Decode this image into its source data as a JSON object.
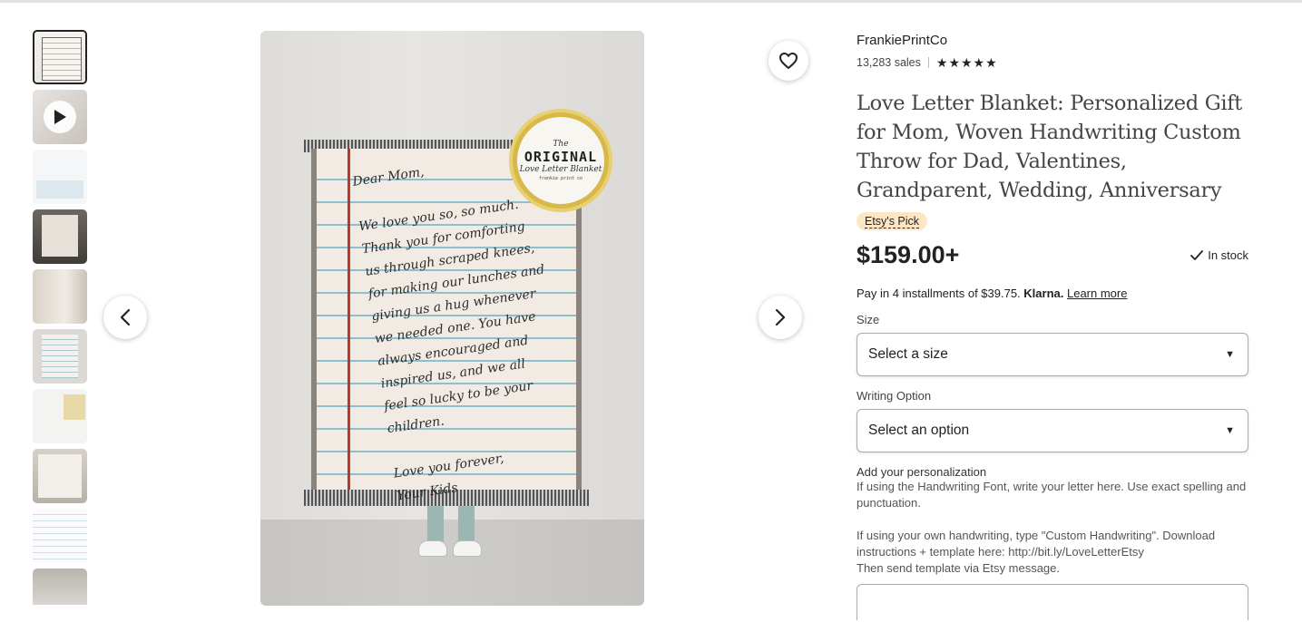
{
  "shop": {
    "name": "FrankiePrintCo",
    "sales": "13,283 sales",
    "stars": "★★★★★"
  },
  "product": {
    "title": "Love Letter Blanket: Personalized Gift for Mom, Woven Handwriting Custom Throw for Dad, Valentines, Grandparent, Wedding, Anniversary",
    "badge": "Etsy's Pick",
    "price": "$159.00+",
    "stock": "In stock",
    "installments_prefix": "Pay in 4 installments of $39.75. ",
    "installments_brand": "Klarna.",
    "learn_more": "Learn more"
  },
  "options": {
    "size_label": "Size",
    "size_placeholder": "Select a size",
    "writing_label": "Writing Option",
    "writing_placeholder": "Select an option"
  },
  "personalization": {
    "title": "Add your personalization",
    "instructions": "If using the Handwriting Font, write your letter here. Use exact spelling and punctuation.\n\nIf using your own handwriting, type \"Custom Handwriting\". Download instructions + template here: http://bit.ly/LoveLetterEtsy\nThen send template via Etsy message."
  },
  "image": {
    "letter": "Dear Mom,\n\nWe love you so, so much.\nThank you for comforting\nus through scraped knees,\nfor making our lunches and\ngiving us a hug whenever\nwe needed one. You have\nalways encouraged and\ninspired us, and we all\nfeel so lucky to be your\nchildren.\n\n      Love you forever,\n          Your Kids",
    "badge_top": "The",
    "badge_main": "ORIGINAL",
    "badge_sub": "Love Letter Blanket",
    "badge_maker": "frankie print co"
  },
  "icons": {
    "play": "play-icon",
    "prev": "chevron-left-icon",
    "next": "chevron-right-icon",
    "favorite": "heart-icon",
    "check": "check-icon",
    "dropdown": "caret-down-icon"
  }
}
